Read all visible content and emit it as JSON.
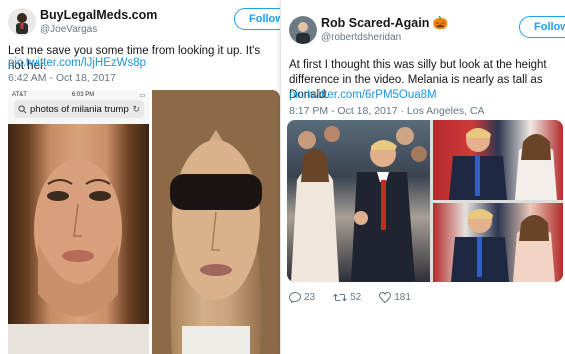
{
  "left_tweet": {
    "name": "BuyLegalMeds.com",
    "handle": "@JoeVargas",
    "follow_label": "Follow",
    "text": "Let me save you some time from looking it up. It's not her.",
    "link": "pic.twitter.com/lJjHEzWs8p",
    "timestamp": "6:42 AM - Oct 18, 2017",
    "screenshot": {
      "carrier": "AT&T",
      "clock": "6:03 PM",
      "search_query": "photos of milania trump"
    }
  },
  "right_tweet": {
    "name": "Rob Scared-Again",
    "name_emoji": "🎃",
    "handle": "@robertdsheridan",
    "follow_label": "Follow",
    "text": "At first I thought this was silly but look at the height difference in the video. Melania is nearly as tall as Donald.",
    "link": "pic.twitter.com/6rPM5Oua8M",
    "timestamp": "8:17 PM - Oct 18, 2017 · Los Angeles, CA",
    "replies": "23",
    "retweets": "52",
    "likes": "181"
  },
  "colors": {
    "link": "#1b95e0",
    "accent": "#1da1f2",
    "muted": "#657786"
  }
}
